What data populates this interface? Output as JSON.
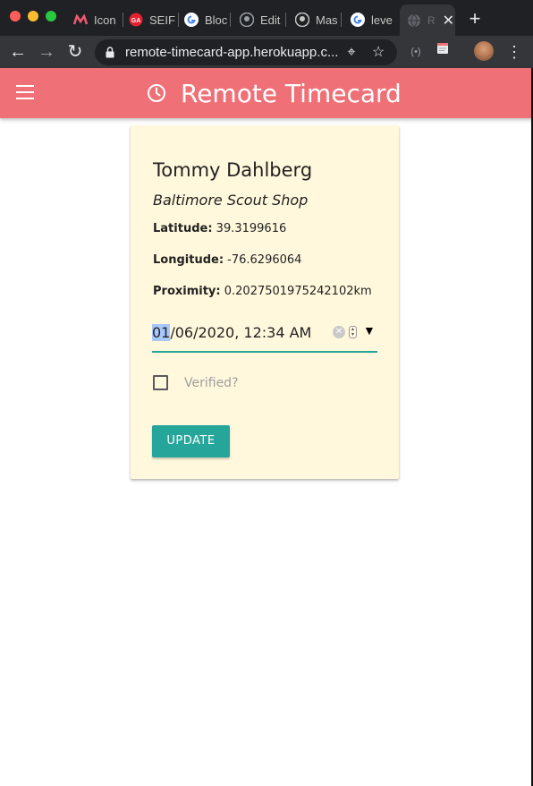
{
  "browser": {
    "tabs": [
      {
        "label": "Icon",
        "icon": "m-logo-icon"
      },
      {
        "label": "SEIF",
        "icon": "ga-logo-icon"
      },
      {
        "label": "Bloc",
        "icon": "google-logo-icon"
      },
      {
        "label": "Edit",
        "icon": "github-logo-icon"
      },
      {
        "label": "Mas",
        "icon": "github-logo-icon"
      },
      {
        "label": "leve",
        "icon": "google-logo-icon"
      },
      {
        "label": "R",
        "icon": "globe-icon",
        "active": true
      }
    ],
    "url": "remote-timecard-app.herokuapp.c..."
  },
  "app": {
    "title": "Remote Timecard",
    "accent_color": "#ef7076",
    "button_color": "#26a69a"
  },
  "card": {
    "name": "Tommy Dahlberg",
    "shop": "Baltimore Scout Shop",
    "latitude_label": "Latitude:",
    "latitude_value": "39.3199616",
    "longitude_label": "Longitude:",
    "longitude_value": "-76.6296064",
    "proximity_label": "Proximity:",
    "proximity_value": "0.2027501975242102km",
    "datetime_selected": "01",
    "datetime_rest": "/06/2020, 12:34 AM",
    "verified_label": "Verified?",
    "verified_checked": false,
    "update_label": "UPDATE"
  }
}
